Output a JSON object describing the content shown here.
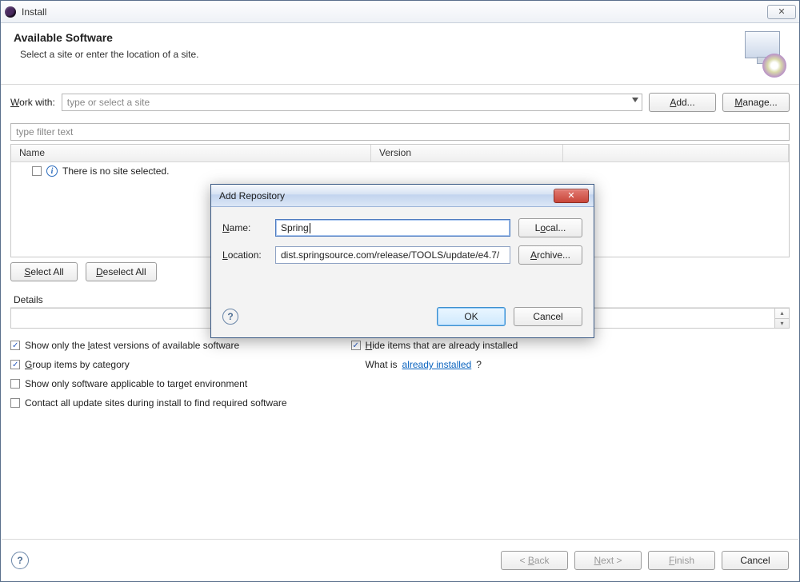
{
  "window": {
    "title": "Install",
    "close_glyph": "✕"
  },
  "header": {
    "heading": "Available Software",
    "subtext": "Select a site or enter the location of a site."
  },
  "work_with": {
    "label": "Work with:",
    "placeholder": "type or select a site",
    "add_label": "Add...",
    "manage_label": "Manage..."
  },
  "filter": {
    "placeholder": "type filter text"
  },
  "table": {
    "columns": {
      "name": "Name",
      "version": "Version"
    },
    "empty_text": "There is no site selected."
  },
  "select": {
    "select_all": "Select All",
    "deselect_all": "Deselect All"
  },
  "details": {
    "label": "Details"
  },
  "options": {
    "latest": "Show only the latest versions of available software",
    "group": "Group items by category",
    "target_env": "Show only software applicable to target environment",
    "contact_sites": "Contact all update sites during install to find required software",
    "hide_installed": "Hide items that are already installed",
    "what_is": "What is ",
    "already_installed_link": "already installed",
    "qmark": "?",
    "checked": {
      "latest": true,
      "group": true,
      "target_env": false,
      "contact_sites": false,
      "hide_installed": true
    }
  },
  "footer": {
    "back": "< Back",
    "next": "Next >",
    "finish": "Finish",
    "cancel": "Cancel"
  },
  "modal": {
    "title": "Add Repository",
    "name_label": "Name:",
    "name_value": "Spring",
    "location_label": "Location:",
    "location_value": "dist.springsource.com/release/TOOLS/update/e4.7/",
    "local_label": "Local...",
    "archive_label": "Archive...",
    "ok": "OK",
    "cancel": "Cancel"
  }
}
